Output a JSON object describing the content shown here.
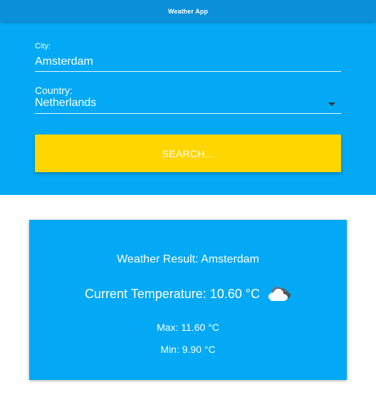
{
  "app": {
    "title": "Weather App"
  },
  "search": {
    "city_label": "City:",
    "city_value": "Amsterdam",
    "country_label": "Country:",
    "country_selected": "Netherlands",
    "button_label": "SEARCH..."
  },
  "result": {
    "title": "Weather Result: Amsterdam",
    "current_temperature": "Current Temperature: 10.60 °C",
    "max": "Max: 11.60 °C",
    "min": "Min: 9.90 °C",
    "icon": "cloud-icon"
  },
  "colors": {
    "app_bar": "#0a8fd8",
    "panel": "#03a9f4",
    "button": "#ffd600",
    "text": "#ffffff"
  }
}
